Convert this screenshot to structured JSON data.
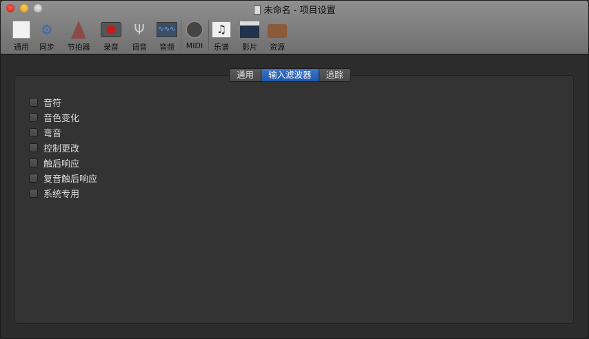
{
  "window": {
    "title": "未命名 - 项目设置"
  },
  "toolbar": [
    {
      "label": "通用",
      "icon": "general-switch-icon"
    },
    {
      "label": "同步",
      "icon": "gears-icon"
    },
    {
      "label": "节拍器",
      "icon": "metronome-icon"
    },
    {
      "label": "录音",
      "icon": "record-icon"
    },
    {
      "label": "调音",
      "icon": "tuning-fork-icon"
    },
    {
      "label": "音频",
      "icon": "waveform-icon"
    },
    {
      "label": "MIDI",
      "icon": "midi-connector-icon"
    },
    {
      "label": "乐谱",
      "icon": "score-notes-icon"
    },
    {
      "label": "影片",
      "icon": "clapperboard-icon"
    },
    {
      "label": "资源",
      "icon": "briefcase-icon"
    }
  ],
  "tabs": [
    {
      "label": "通用",
      "selected": false
    },
    {
      "label": "输入滤波器",
      "selected": true
    },
    {
      "label": "追踪",
      "selected": false
    }
  ],
  "filters": [
    {
      "label": "音符",
      "checked": false
    },
    {
      "label": "音色变化",
      "checked": false
    },
    {
      "label": "弯音",
      "checked": false
    },
    {
      "label": "控制更改",
      "checked": false
    },
    {
      "label": "触后响应",
      "checked": false
    },
    {
      "label": "复音触后响应",
      "checked": false
    },
    {
      "label": "系统专用",
      "checked": false
    }
  ]
}
